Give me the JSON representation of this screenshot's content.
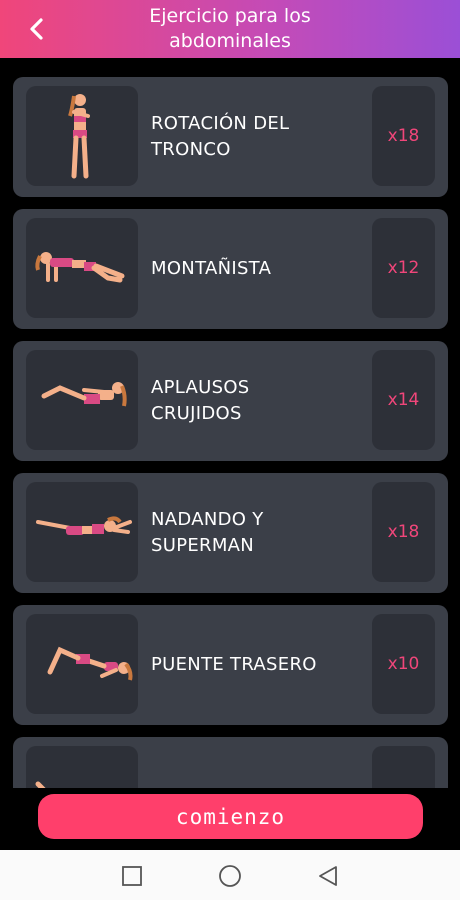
{
  "header": {
    "title": "Ejercicio para los\nabdominales",
    "back_icon": "chevron-left-icon"
  },
  "exercises": [
    {
      "name": "ROTACIÓN DEL\nTRONCO",
      "reps": "x18"
    },
    {
      "name": "MONTAÑISTA",
      "reps": "x12"
    },
    {
      "name": "APLAUSOS\nCRUJIDOS",
      "reps": "x14"
    },
    {
      "name": "NADANDO Y\nSUPERMAN",
      "reps": "x18"
    },
    {
      "name": "PUENTE TRASERO",
      "reps": "x10"
    },
    {
      "name": "",
      "reps": ""
    }
  ],
  "start_button": {
    "label": "comienzo"
  },
  "navbar": {
    "items": [
      "square-icon",
      "circle-icon",
      "triangle-back-icon"
    ]
  },
  "colors": {
    "accent": "#ff3f6b",
    "card": "#3b3f48",
    "thumb": "#2d3038",
    "header_start": "#f0467a",
    "header_end": "#9b4fd6"
  }
}
